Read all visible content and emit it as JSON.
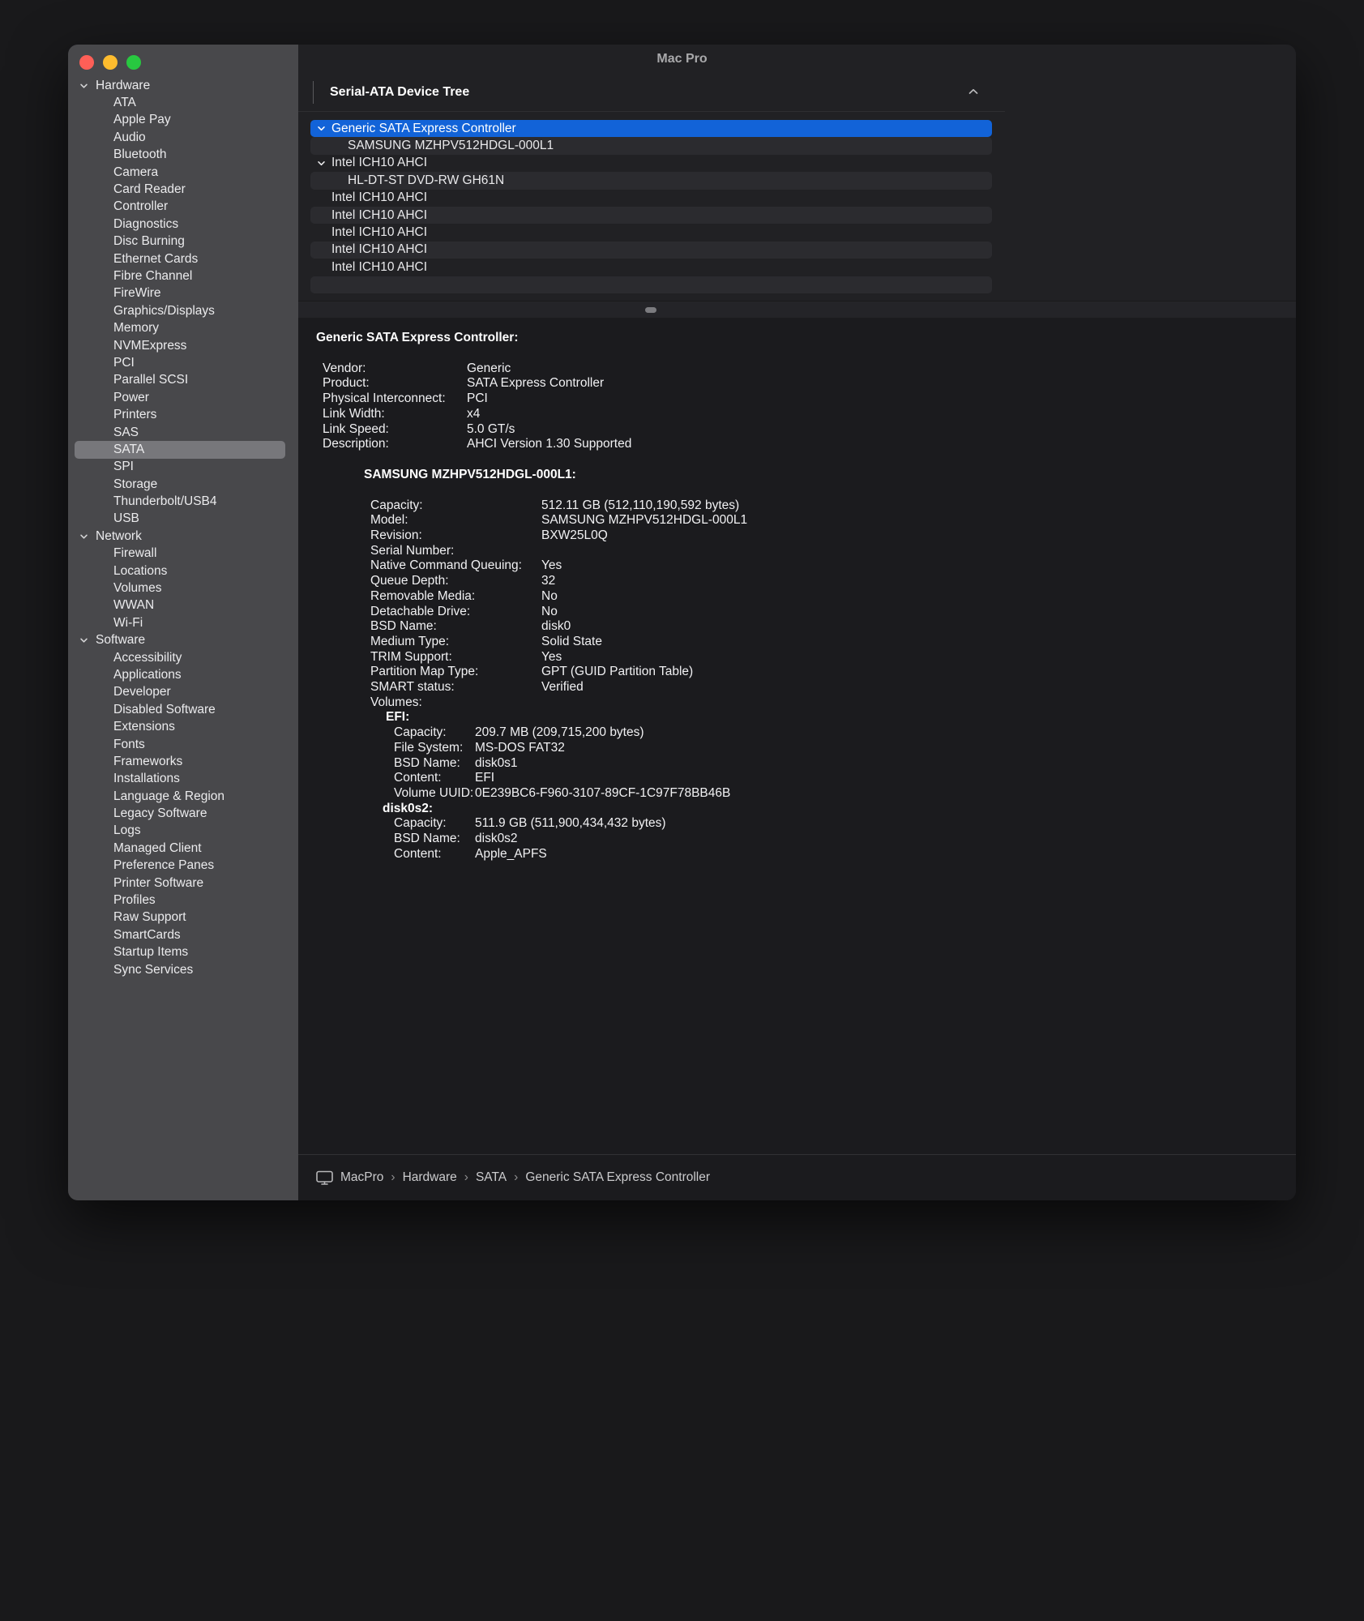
{
  "window": {
    "title": "Mac Pro"
  },
  "sidebar": {
    "selected": "SATA",
    "sections": [
      {
        "label": "Hardware",
        "children": [
          "ATA",
          "Apple Pay",
          "Audio",
          "Bluetooth",
          "Camera",
          "Card Reader",
          "Controller",
          "Diagnostics",
          "Disc Burning",
          "Ethernet Cards",
          "Fibre Channel",
          "FireWire",
          "Graphics/Displays",
          "Memory",
          "NVMExpress",
          "PCI",
          "Parallel SCSI",
          "Power",
          "Printers",
          "SAS",
          "SATA",
          "SPI",
          "Storage",
          "Thunderbolt/USB4",
          "USB"
        ]
      },
      {
        "label": "Network",
        "children": [
          "Firewall",
          "Locations",
          "Volumes",
          "WWAN",
          "Wi-Fi"
        ]
      },
      {
        "label": "Software",
        "children": [
          "Accessibility",
          "Applications",
          "Developer",
          "Disabled Software",
          "Extensions",
          "Fonts",
          "Frameworks",
          "Installations",
          "Language & Region",
          "Legacy Software",
          "Logs",
          "Managed Client",
          "Preference Panes",
          "Printer Software",
          "Profiles",
          "Raw Support",
          "SmartCards",
          "Startup Items",
          "Sync Services"
        ]
      }
    ]
  },
  "tree": {
    "header": "Serial-ATA Device Tree",
    "rows": [
      {
        "label": "Generic SATA Express Controller",
        "indent": 0,
        "chevron": true,
        "selected": true
      },
      {
        "label": "SAMSUNG MZHPV512HDGL-000L1",
        "indent": 1,
        "chevron": false,
        "selected": false
      },
      {
        "label": "Intel ICH10 AHCI",
        "indent": 0,
        "chevron": true,
        "selected": false
      },
      {
        "label": "HL-DT-ST DVD-RW GH61N",
        "indent": 1,
        "chevron": false,
        "selected": false
      },
      {
        "label": "Intel ICH10 AHCI",
        "indent": 0,
        "chevron": false,
        "selected": false
      },
      {
        "label": "Intel ICH10 AHCI",
        "indent": 0,
        "chevron": false,
        "selected": false
      },
      {
        "label": "Intel ICH10 AHCI",
        "indent": 0,
        "chevron": false,
        "selected": false
      },
      {
        "label": "Intel ICH10 AHCI",
        "indent": 0,
        "chevron": false,
        "selected": false
      },
      {
        "label": "Intel ICH10 AHCI",
        "indent": 0,
        "chevron": false,
        "selected": false
      },
      {
        "label": "",
        "indent": 0,
        "chevron": false,
        "selected": false
      }
    ]
  },
  "details": {
    "controller": {
      "title": "Generic SATA Express Controller:",
      "rows": [
        [
          "Vendor:",
          "Generic"
        ],
        [
          "Product:",
          "SATA Express Controller"
        ],
        [
          "Physical Interconnect:",
          "PCI"
        ],
        [
          "Link Width:",
          "x4"
        ],
        [
          "Link Speed:",
          "5.0 GT/s"
        ],
        [
          "Description:",
          "AHCI Version 1.30 Supported"
        ]
      ]
    },
    "drive": {
      "title": "SAMSUNG MZHPV512HDGL-000L1:",
      "rows": [
        [
          "Capacity:",
          "512.11 GB (512,110,190,592 bytes)"
        ],
        [
          "Model:",
          "SAMSUNG MZHPV512HDGL-000L1"
        ],
        [
          "Revision:",
          "BXW25L0Q"
        ],
        [
          "Serial Number:",
          ""
        ],
        [
          "Native Command Queuing:",
          "Yes"
        ],
        [
          "Queue Depth:",
          "32"
        ],
        [
          "Removable Media:",
          "No"
        ],
        [
          "Detachable Drive:",
          "No"
        ],
        [
          "BSD Name:",
          "disk0"
        ],
        [
          "Medium Type:",
          "Solid State"
        ],
        [
          "TRIM Support:",
          "Yes"
        ],
        [
          "Partition Map Type:",
          "GPT (GUID Partition Table)"
        ],
        [
          "SMART status:",
          "Verified"
        ],
        [
          "Volumes:",
          ""
        ]
      ]
    },
    "efi": {
      "title": "EFI:",
      "rows": [
        [
          "Capacity:",
          "209.7 MB (209,715,200 bytes)"
        ],
        [
          "File System:",
          "MS-DOS FAT32"
        ],
        [
          "BSD Name:",
          "disk0s1"
        ],
        [
          "Content:",
          "EFI"
        ],
        [
          "Volume UUID:",
          "0E239BC6-F960-3107-89CF-1C97F78BB46B"
        ]
      ]
    },
    "disk0s2": {
      "title": "disk0s2:",
      "rows": [
        [
          "Capacity:",
          "511.9 GB (511,900,434,432 bytes)"
        ],
        [
          "BSD Name:",
          "disk0s2"
        ],
        [
          "Content:",
          "Apple_APFS"
        ]
      ]
    }
  },
  "breadcrumb": {
    "separator": "›",
    "items": [
      "MacPro",
      "Hardware",
      "SATA",
      "Generic SATA Express Controller"
    ]
  },
  "colors": {
    "selection_blue": "#1263d8",
    "sidebar_selected": "#77777b",
    "row_stripe": "#2b2b2f",
    "sidebar_bg": "#48484b",
    "content_bg": "#212124",
    "details_bg": "#1b1b1e"
  }
}
